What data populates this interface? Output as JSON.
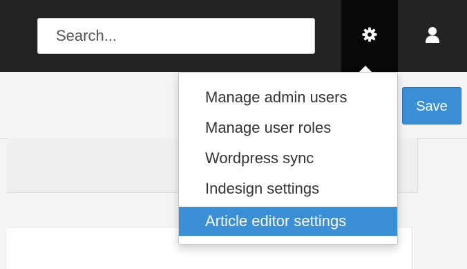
{
  "search": {
    "placeholder": "Search..."
  },
  "header": {
    "settings_icon": "gear-icon",
    "user_icon": "user-icon"
  },
  "toolbar": {
    "save_label": "Save"
  },
  "settings_menu": {
    "items": [
      {
        "label": "Manage admin users"
      },
      {
        "label": "Manage user roles"
      },
      {
        "label": "Wordpress sync"
      },
      {
        "label": "Indesign settings"
      },
      {
        "label": "Article editor settings",
        "active": true
      }
    ]
  },
  "colors": {
    "topbar": "#222222",
    "active_tile": "#080808",
    "accent": "#3b8fd5"
  }
}
